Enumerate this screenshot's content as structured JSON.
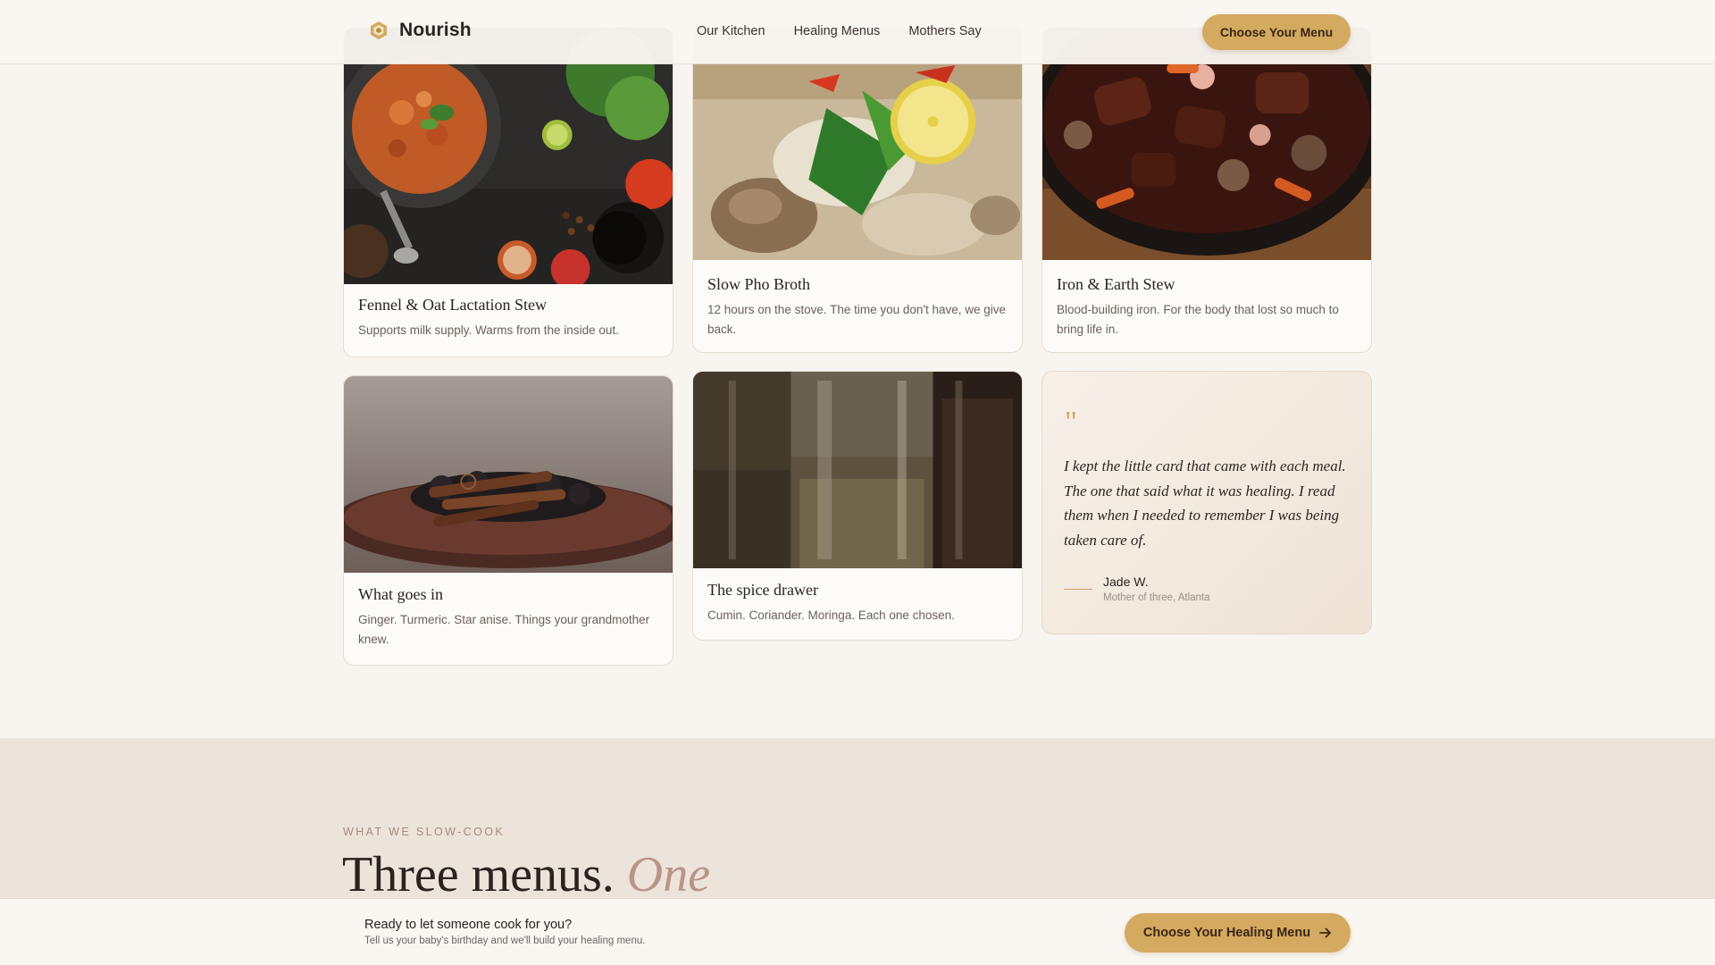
{
  "header": {
    "brand": "Nourish",
    "nav": [
      "Our Kitchen",
      "Healing Menus",
      "Mothers Say"
    ],
    "cta": "Choose Your Menu"
  },
  "cards": [
    {
      "title": "Fennel & Oat Lactation Stew",
      "desc": "Supports milk supply. Warms from the inside out."
    },
    {
      "title": "Slow Pho Broth",
      "desc": "12 hours on the stove. The time you don't have, we give back."
    },
    {
      "title": "Iron & Earth Stew",
      "desc": "Blood-building iron. For the body that lost so much to bring life in."
    },
    {
      "title": "What goes in",
      "desc": "Ginger. Turmeric. Star anise. Things your grandmother knew."
    },
    {
      "title": "The spice drawer",
      "desc": "Cumin. Coriander. Moringa. Each one chosen."
    }
  ],
  "testimonial": {
    "mark": "\"",
    "quote": "I kept the little card that came with each meal. The one that said what it was healing. I read them when I needed to remember I was being taken care of.",
    "author": "Jade W.",
    "role": "Mother of three, Atlanta"
  },
  "section": {
    "eyebrow": "WHAT WE SLOW-COOK",
    "title_main": "Three menus.",
    "title_accent": "One"
  },
  "bottom_bar": {
    "title": "Ready to let someone cook for you?",
    "subtitle": "Tell us your baby's birthday and we'll build your healing menu.",
    "cta": "Choose Your Healing Menu"
  },
  "icons": {
    "logo": "hexagon-logo-icon",
    "cta_arrow": "arrow-right-icon"
  },
  "colors": {
    "accent": "#d4a960",
    "background": "#f8f4ef",
    "section": "#ece3da"
  }
}
